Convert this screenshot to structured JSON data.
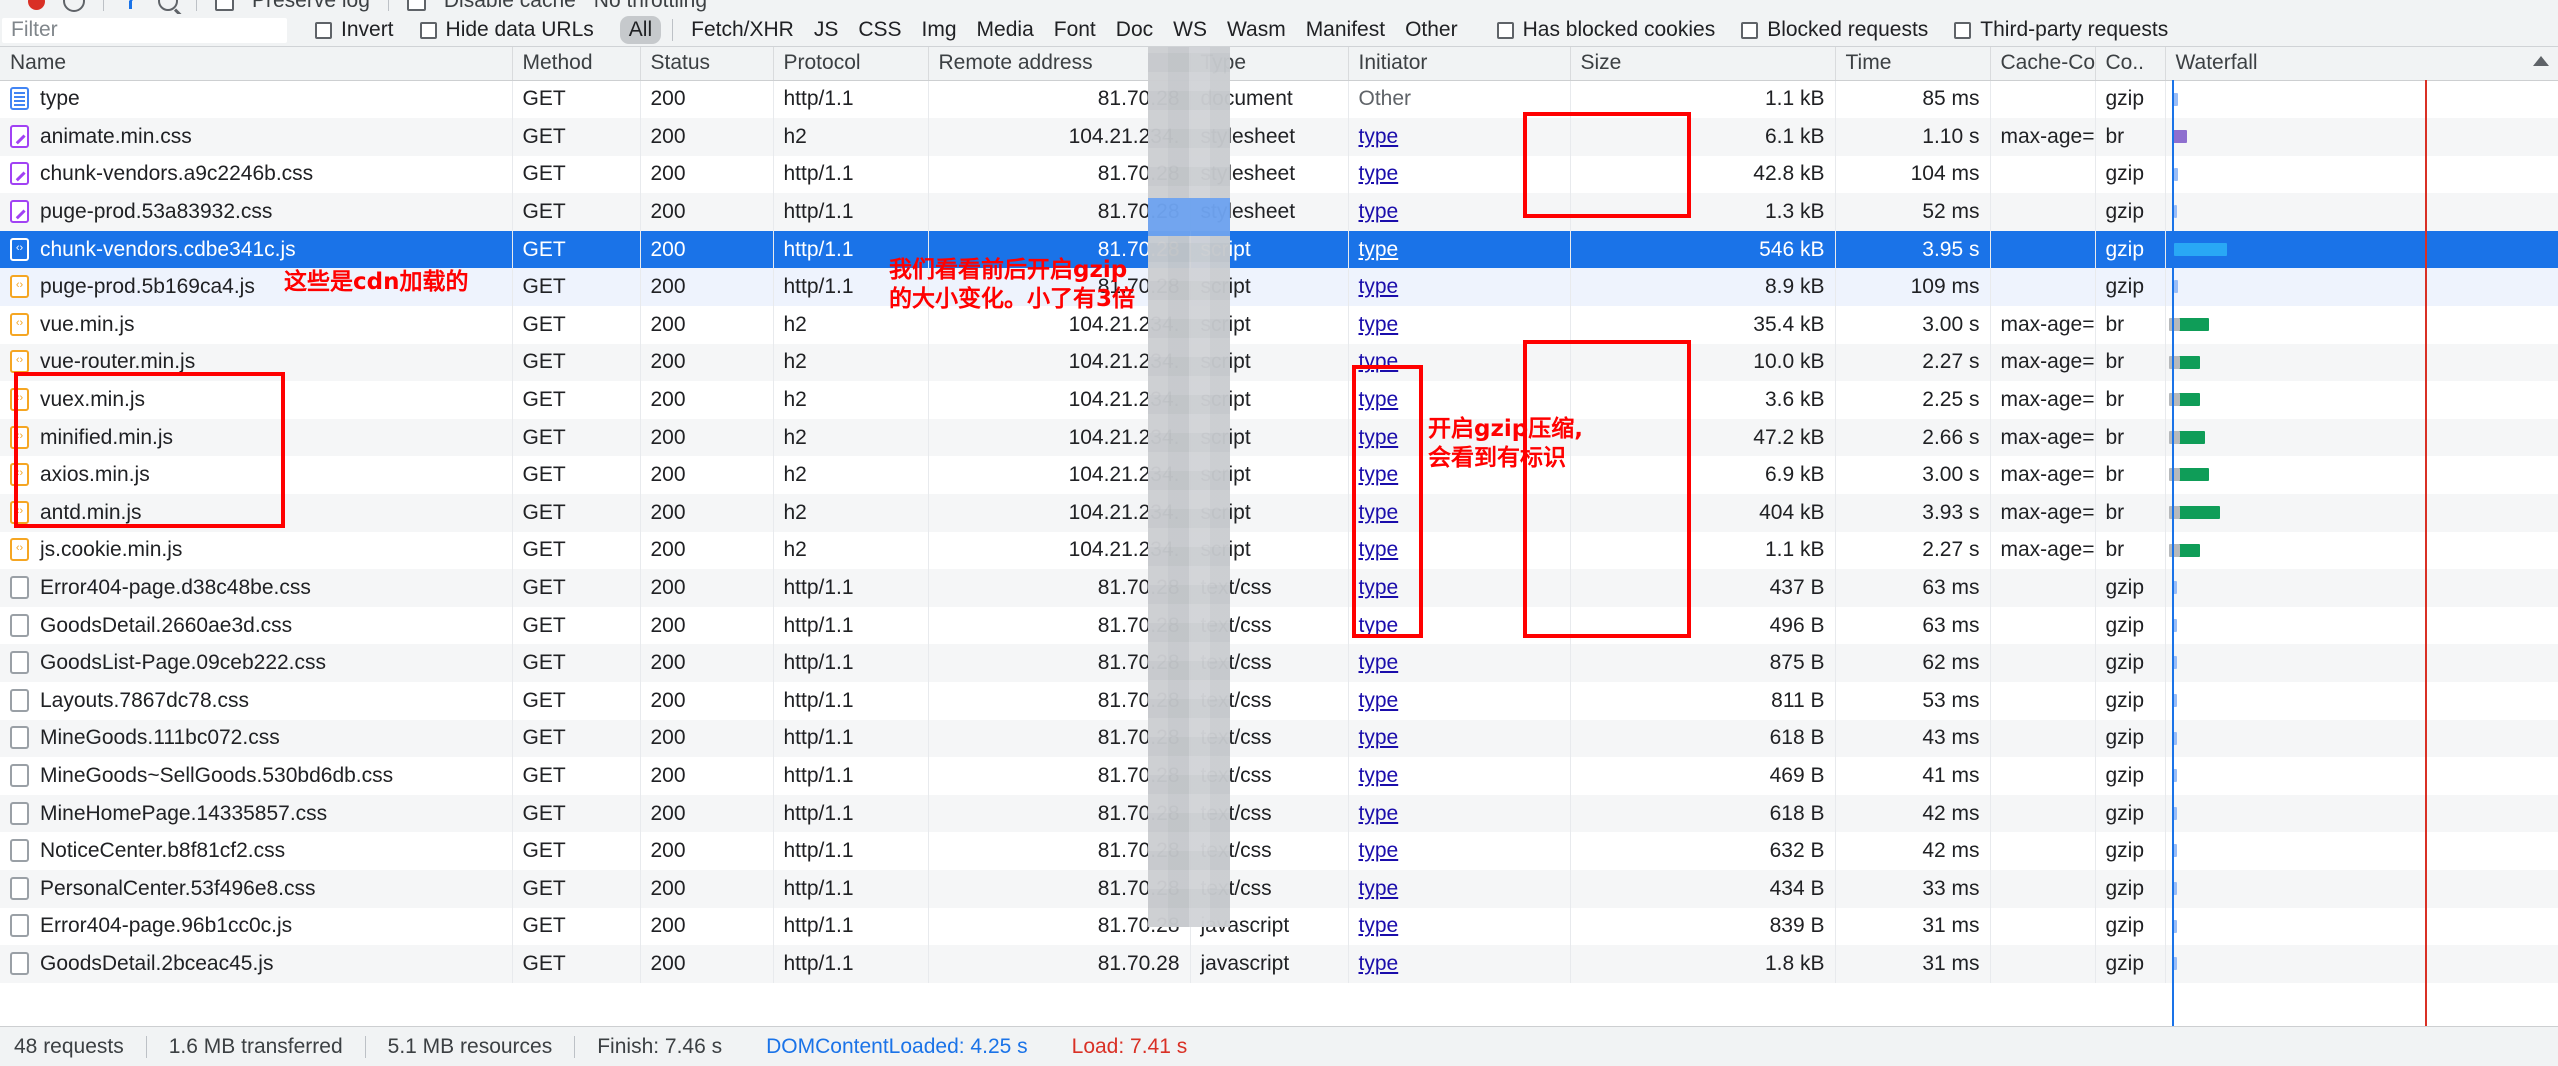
{
  "toolbar": {
    "record_label": "record-button",
    "clear_label": "clear-button",
    "preserve_log": "Preserve log",
    "disable_cache": "Disable cache",
    "throttling": "No throttling"
  },
  "filterbar": {
    "filter_placeholder": "Filter",
    "invert": "Invert",
    "hide_data_urls": "Hide data URLs",
    "types": [
      "All",
      "Fetch/XHR",
      "JS",
      "CSS",
      "Img",
      "Media",
      "Font",
      "Doc",
      "WS",
      "Wasm",
      "Manifest",
      "Other"
    ],
    "active_type": "All",
    "has_blocked_cookies": "Has blocked cookies",
    "blocked_requests": "Blocked requests",
    "third_party_requests": "Third-party requests"
  },
  "columns": [
    "Name",
    "Method",
    "Status",
    "Protocol",
    "Remote address",
    "Type",
    "Initiator",
    "Size",
    "Time",
    "Cache-Con...",
    "Co..",
    "Waterfall"
  ],
  "rows": [
    {
      "name": "type",
      "icon": "doc",
      "method": "GET",
      "status": "200",
      "protocol": "http/1.1",
      "remote": "81.70.28",
      "type": "document",
      "initiator": "Other",
      "initiator_link": false,
      "size": "1.1 kB",
      "time": "85 ms",
      "cache": "",
      "content": "gzip",
      "wf_start": 1.0,
      "wf_width": 1.2,
      "wf_color": "#9bbef7",
      "selected": false
    },
    {
      "name": "animate.min.css",
      "icon": "css",
      "method": "GET",
      "status": "200",
      "protocol": "h2",
      "remote": "104.21.234.",
      "type": "stylesheet",
      "initiator": "type",
      "initiator_link": true,
      "size": "6.1 kB",
      "time": "1.10 s",
      "cache": "max-age=4...",
      "content": "br",
      "wf_start": 1.0,
      "wf_width": 3.6,
      "wf_color": "#8e6fcf",
      "selected": false
    },
    {
      "name": "chunk-vendors.a9c2246b.css",
      "icon": "css",
      "method": "GET",
      "status": "200",
      "protocol": "http/1.1",
      "remote": "81.70.28",
      "type": "stylesheet",
      "initiator": "type",
      "initiator_link": true,
      "size": "42.8 kB",
      "time": "104 ms",
      "cache": "",
      "content": "gzip",
      "wf_start": 1.1,
      "wf_width": 1.0,
      "wf_color": "#9bbef7",
      "selected": false
    },
    {
      "name": "puge-prod.53a83932.css",
      "icon": "css",
      "method": "GET",
      "status": "200",
      "protocol": "http/1.1",
      "remote": "81.70.28",
      "type": "stylesheet",
      "initiator": "type",
      "initiator_link": true,
      "size": "1.3 kB",
      "time": "52 ms",
      "cache": "",
      "content": "gzip",
      "wf_start": 1.1,
      "wf_width": 0.8,
      "wf_color": "#9bbef7",
      "selected": false
    },
    {
      "name": "chunk-vendors.cdbe341c.js",
      "icon": "jsblue",
      "method": "GET",
      "status": "200",
      "protocol": "http/1.1",
      "remote": "81.70.28",
      "type": "script",
      "initiator": "type",
      "initiator_link": true,
      "size": "546 kB",
      "time": "3.95 s",
      "cache": "",
      "content": "gzip",
      "wf_start": 1.1,
      "wf_width": 13.5,
      "wf_color": "#29a8f5",
      "selected": true
    },
    {
      "name": "puge-prod.5b169ca4.js",
      "icon": "js",
      "method": "GET",
      "status": "200",
      "protocol": "http/1.1",
      "remote": "81.70.28",
      "type": "script",
      "initiator": "type",
      "initiator_link": true,
      "size": "8.9 kB",
      "time": "109 ms",
      "cache": "",
      "content": "gzip",
      "wf_start": 1.1,
      "wf_width": 1.0,
      "wf_color": "#9bbef7",
      "selected": false
    },
    {
      "name": "vue.min.js",
      "icon": "js",
      "method": "GET",
      "status": "200",
      "protocol": "h2",
      "remote": "104.21.234.",
      "type": "script",
      "initiator": "type",
      "initiator_link": true,
      "size": "35.4 kB",
      "time": "3.00 s",
      "cache": "max-age=4...",
      "content": "br",
      "wf_start": 1.0,
      "wf_width": 9.2,
      "wf_color": "#0f9d58",
      "selected": false
    },
    {
      "name": "vue-router.min.js",
      "icon": "js",
      "method": "GET",
      "status": "200",
      "protocol": "h2",
      "remote": "104.21.234.",
      "type": "script",
      "initiator": "type",
      "initiator_link": true,
      "size": "10.0 kB",
      "time": "2.27 s",
      "cache": "max-age=4...",
      "content": "br",
      "wf_start": 1.0,
      "wf_width": 6.8,
      "wf_color": "#0f9d58",
      "selected": false
    },
    {
      "name": "vuex.min.js",
      "icon": "js",
      "method": "GET",
      "status": "200",
      "protocol": "h2",
      "remote": "104.21.234.",
      "type": "script",
      "initiator": "type",
      "initiator_link": true,
      "size": "3.6 kB",
      "time": "2.25 s",
      "cache": "max-age=4...",
      "content": "br",
      "wf_start": 1.0,
      "wf_width": 6.7,
      "wf_color": "#0f9d58",
      "selected": false
    },
    {
      "name": "minified.min.js",
      "icon": "js",
      "method": "GET",
      "status": "200",
      "protocol": "h2",
      "remote": "104.21.234.",
      "type": "script",
      "initiator": "type",
      "initiator_link": true,
      "size": "47.2 kB",
      "time": "2.66 s",
      "cache": "max-age=4...",
      "content": "br",
      "wf_start": 1.0,
      "wf_width": 8.0,
      "wf_color": "#0f9d58",
      "selected": false
    },
    {
      "name": "axios.min.js",
      "icon": "js",
      "method": "GET",
      "status": "200",
      "protocol": "h2",
      "remote": "104.21.234.",
      "type": "script",
      "initiator": "type",
      "initiator_link": true,
      "size": "6.9 kB",
      "time": "3.00 s",
      "cache": "max-age=4...",
      "content": "br",
      "wf_start": 1.0,
      "wf_width": 9.0,
      "wf_color": "#0f9d58",
      "selected": false
    },
    {
      "name": "antd.min.js",
      "icon": "js",
      "method": "GET",
      "status": "200",
      "protocol": "h2",
      "remote": "104.21.234.",
      "type": "script",
      "initiator": "type",
      "initiator_link": true,
      "size": "404 kB",
      "time": "3.93 s",
      "cache": "max-age=4...",
      "content": "br",
      "wf_start": 1.0,
      "wf_width": 12.0,
      "wf_color": "#0f9d58",
      "selected": false
    },
    {
      "name": "js.cookie.min.js",
      "icon": "js",
      "method": "GET",
      "status": "200",
      "protocol": "h2",
      "remote": "104.21.234.",
      "type": "script",
      "initiator": "type",
      "initiator_link": true,
      "size": "1.1 kB",
      "time": "2.27 s",
      "cache": "max-age=4...",
      "content": "br",
      "wf_start": 1.0,
      "wf_width": 6.8,
      "wf_color": "#0f9d58",
      "selected": false
    },
    {
      "name": "Error404-page.d38c48be.css",
      "icon": "plain",
      "method": "GET",
      "status": "200",
      "protocol": "http/1.1",
      "remote": "81.70.28",
      "type": "text/css",
      "initiator": "type",
      "initiator_link": true,
      "size": "437 B",
      "time": "63 ms",
      "cache": "",
      "content": "gzip",
      "wf_start": 1.0,
      "wf_width": 0.5,
      "wf_color": "#9bbef7",
      "selected": false
    },
    {
      "name": "GoodsDetail.2660ae3d.css",
      "icon": "plain",
      "method": "GET",
      "status": "200",
      "protocol": "http/1.1",
      "remote": "81.70.28",
      "type": "text/css",
      "initiator": "type",
      "initiator_link": true,
      "size": "496 B",
      "time": "63 ms",
      "cache": "",
      "content": "gzip",
      "wf_start": 1.0,
      "wf_width": 0.5,
      "wf_color": "#9bbef7",
      "selected": false
    },
    {
      "name": "GoodsList-Page.09ceb222.css",
      "icon": "plain",
      "method": "GET",
      "status": "200",
      "protocol": "http/1.1",
      "remote": "81.70.28",
      "type": "text/css",
      "initiator": "type",
      "initiator_link": true,
      "size": "875 B",
      "time": "62 ms",
      "cache": "",
      "content": "gzip",
      "wf_start": 1.0,
      "wf_width": 0.5,
      "wf_color": "#9bbef7",
      "selected": false
    },
    {
      "name": "Layouts.7867dc78.css",
      "icon": "plain",
      "method": "GET",
      "status": "200",
      "protocol": "http/1.1",
      "remote": "81.70.28",
      "type": "text/css",
      "initiator": "type",
      "initiator_link": true,
      "size": "811 B",
      "time": "53 ms",
      "cache": "",
      "content": "gzip",
      "wf_start": 1.0,
      "wf_width": 0.5,
      "wf_color": "#9bbef7",
      "selected": false
    },
    {
      "name": "MineGoods.111bc072.css",
      "icon": "plain",
      "method": "GET",
      "status": "200",
      "protocol": "http/1.1",
      "remote": "81.70.28",
      "type": "text/css",
      "initiator": "type",
      "initiator_link": true,
      "size": "618 B",
      "time": "43 ms",
      "cache": "",
      "content": "gzip",
      "wf_start": 1.0,
      "wf_width": 0.4,
      "wf_color": "#9bbef7",
      "selected": false
    },
    {
      "name": "MineGoods~SellGoods.530bd6db.css",
      "icon": "plain",
      "method": "GET",
      "status": "200",
      "protocol": "http/1.1",
      "remote": "81.70.28",
      "type": "text/css",
      "initiator": "type",
      "initiator_link": true,
      "size": "469 B",
      "time": "41 ms",
      "cache": "",
      "content": "gzip",
      "wf_start": 1.0,
      "wf_width": 0.4,
      "wf_color": "#9bbef7",
      "selected": false
    },
    {
      "name": "MineHomePage.14335857.css",
      "icon": "plain",
      "method": "GET",
      "status": "200",
      "protocol": "http/1.1",
      "remote": "81.70.28",
      "type": "text/css",
      "initiator": "type",
      "initiator_link": true,
      "size": "618 B",
      "time": "42 ms",
      "cache": "",
      "content": "gzip",
      "wf_start": 1.0,
      "wf_width": 0.4,
      "wf_color": "#9bbef7",
      "selected": false
    },
    {
      "name": "NoticeCenter.b8f81cf2.css",
      "icon": "plain",
      "method": "GET",
      "status": "200",
      "protocol": "http/1.1",
      "remote": "81.70.28",
      "type": "text/css",
      "initiator": "type",
      "initiator_link": true,
      "size": "632 B",
      "time": "42 ms",
      "cache": "",
      "content": "gzip",
      "wf_start": 1.0,
      "wf_width": 0.4,
      "wf_color": "#9bbef7",
      "selected": false
    },
    {
      "name": "PersonalCenter.53f496e8.css",
      "icon": "plain",
      "method": "GET",
      "status": "200",
      "protocol": "http/1.1",
      "remote": "81.70.28",
      "type": "text/css",
      "initiator": "type",
      "initiator_link": true,
      "size": "434 B",
      "time": "33 ms",
      "cache": "",
      "content": "gzip",
      "wf_start": 1.0,
      "wf_width": 0.35,
      "wf_color": "#9bbef7",
      "selected": false
    },
    {
      "name": "Error404-page.96b1cc0c.js",
      "icon": "plain",
      "method": "GET",
      "status": "200",
      "protocol": "http/1.1",
      "remote": "81.70.28",
      "type": "javascript",
      "initiator": "type",
      "initiator_link": true,
      "size": "839 B",
      "time": "31 ms",
      "cache": "",
      "content": "gzip",
      "wf_start": 1.0,
      "wf_width": 0.35,
      "wf_color": "#9bbef7",
      "selected": false
    },
    {
      "name": "GoodsDetail.2bceac45.js",
      "icon": "plain",
      "method": "GET",
      "status": "200",
      "protocol": "http/1.1",
      "remote": "81.70.28",
      "type": "javascript",
      "initiator": "type",
      "initiator_link": true,
      "size": "1.8 kB",
      "time": "31 ms",
      "cache": "",
      "content": "gzip",
      "wf_start": 1.0,
      "wf_width": 0.35,
      "wf_color": "#9bbef7",
      "selected": false
    }
  ],
  "annotations": {
    "cdn_note": "这些是cdn加载的",
    "gzip_compare_note": "我们看看前后开启gzip\n的大小变化。小了有3倍",
    "gzip_flag_note": "开启gzip压缩,\n会看到有标识"
  },
  "statusbar": {
    "requests": "48 requests",
    "transferred": "1.6 MB transferred",
    "resources": "5.1 MB resources",
    "finish": "Finish: 7.46 s",
    "dom_content_loaded": "DOMContentLoaded: 4.25 s",
    "load": "Load: 7.41 s"
  }
}
